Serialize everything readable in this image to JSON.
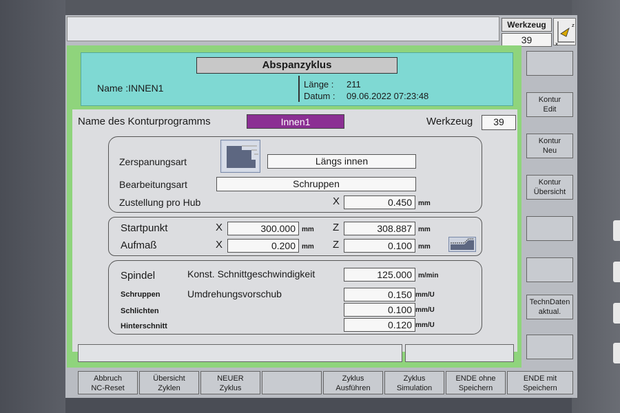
{
  "tool_display": {
    "label": "Werkzeug",
    "number": "39"
  },
  "header": {
    "title": "Abspanzyklus",
    "name_label": "Name :",
    "name_value": "INNEN1",
    "length_label": "Länge :",
    "length_value": "211",
    "date_label": "Datum :",
    "date_value": "09.06.2022 07:23:48"
  },
  "program": {
    "name_label": "Name des Konturprogramms",
    "name_value": "Innen1",
    "tool_label": "Werkzeug",
    "tool_value": "39"
  },
  "machining": {
    "type_label": "Zerspanungsart",
    "type_value": "Längs innen",
    "mode_label": "Bearbeitungsart",
    "mode_value": "Schruppen",
    "infeed_label": "Zustellung pro Hub",
    "infeed_axis": "X",
    "infeed_value": "0.450",
    "infeed_unit": "mm"
  },
  "position": {
    "start_label": "Startpunkt",
    "start_x_axis": "X",
    "start_x": "300.000",
    "start_x_unit": "mm",
    "start_z_axis": "Z",
    "start_z": "308.887",
    "start_z_unit": "mm",
    "allowance_label": "Aufmaß",
    "allowance_x_axis": "X",
    "allowance_x": "0.200",
    "allowance_x_unit": "mm",
    "allowance_z_axis": "Z",
    "allowance_z": "0.100",
    "allowance_z_unit": "mm"
  },
  "spindle": {
    "label": "Spindel",
    "css_label": "Konst. Schnittgeschwindigkeit",
    "css_value": "125.000",
    "css_unit": "m/min",
    "roughing_label": "Schruppen",
    "feed_label": "Umdrehungsvorschub",
    "roughing_value": "0.150",
    "roughing_unit": "mm/U",
    "finishing_label": "Schlichten",
    "finishing_value": "0.100",
    "finishing_unit": "mm/U",
    "undercut_label": "Hinterschnitt",
    "undercut_value": "0.120",
    "undercut_unit": "mm/U"
  },
  "side_softkeys": [
    {
      "line1": "",
      "line2": ""
    },
    {
      "line1": "Kontur",
      "line2": "Edit"
    },
    {
      "line1": "Kontur",
      "line2": "Neu"
    },
    {
      "line1": "Kontur",
      "line2": "Übersicht"
    },
    {
      "line1": "",
      "line2": ""
    },
    {
      "line1": "",
      "line2": ""
    },
    {
      "line1": "TechnDaten",
      "line2": "aktual."
    },
    {
      "line1": "",
      "line2": ""
    }
  ],
  "bottom_softkeys": [
    {
      "line1": "Abbruch",
      "line2": "NC-Reset"
    },
    {
      "line1": "Übersicht",
      "line2": "Zyklen"
    },
    {
      "line1": "NEUER",
      "line2": "Zyklus"
    },
    {
      "line1": "",
      "line2": ""
    },
    {
      "line1": "Zyklus",
      "line2": "Ausführen"
    },
    {
      "line1": "Zyklus",
      "line2": "Simulation"
    },
    {
      "line1": "ENDE ohne",
      "line2": "Speichern"
    },
    {
      "line1": "ENDE mit",
      "line2": "Speichern"
    }
  ],
  "icons": {
    "axis": "axis-orientation-icon",
    "contour": "inner-contour-icon",
    "allowance": "allowance-contour-icon"
  },
  "colors": {
    "header_bg": "#7fd9d3",
    "frame_green": "#8fd47c",
    "program_highlight": "#8b2f93"
  }
}
